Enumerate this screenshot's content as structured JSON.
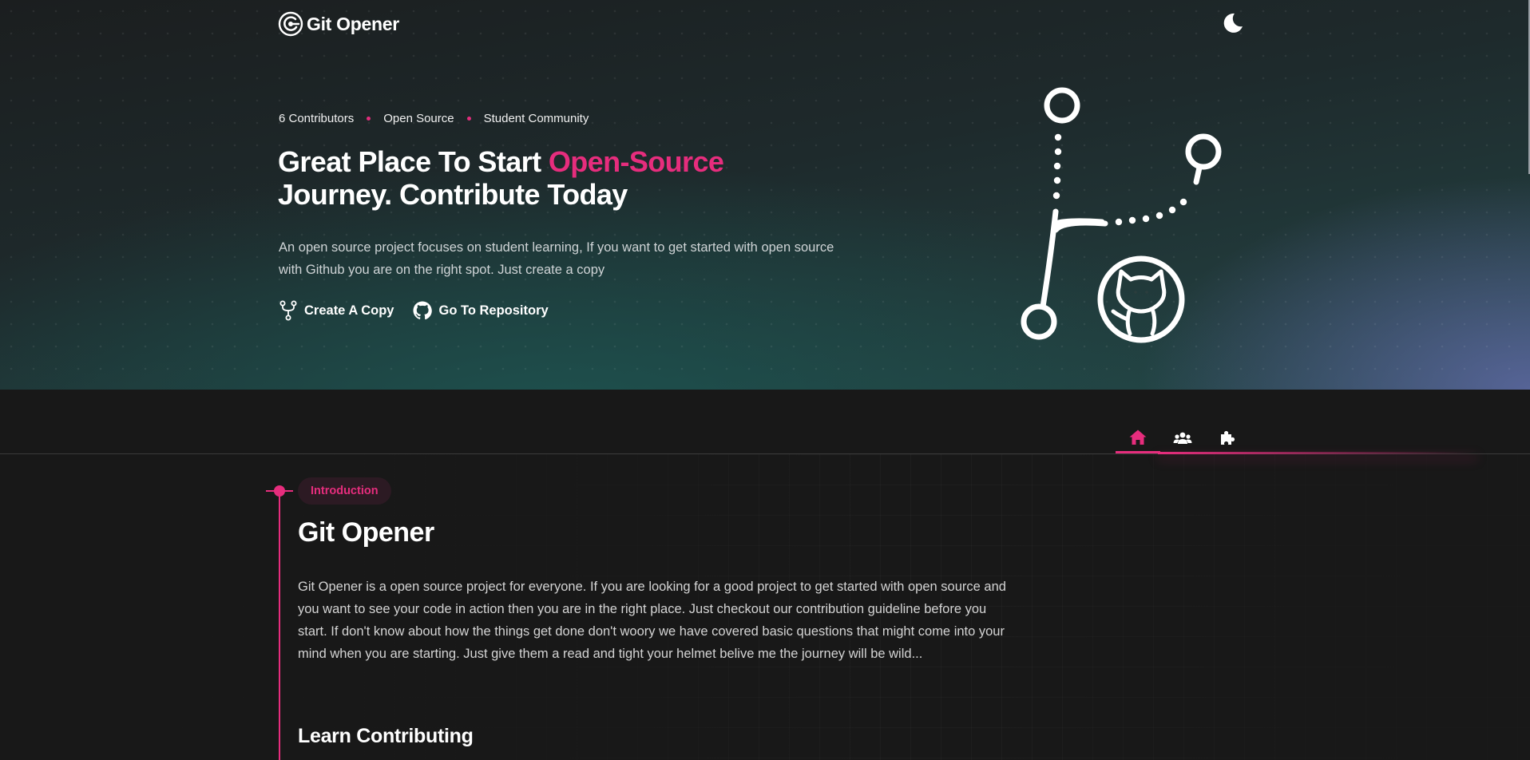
{
  "header": {
    "logo_text": "Git Opener",
    "theme_toggle_icon": "moon-icon"
  },
  "hero": {
    "meta": [
      "6 Contributors",
      "Open Source",
      "Student Community"
    ],
    "headline_part1": "Great Place To Start ",
    "headline_accent": "Open-Source",
    "headline_part2": "Journey. Contribute Today",
    "description": "An open source project focuses on student learning, If you want to get started with open source with Github you are on the right spot. Just create a copy",
    "actions": [
      {
        "label": "Create A Copy",
        "icon": "fork-icon"
      },
      {
        "label": "Go To Repository",
        "icon": "github-icon"
      }
    ],
    "illustration": "git-branch-octocat-illustration"
  },
  "nav": {
    "icons": [
      {
        "name": "home-icon",
        "active": true
      },
      {
        "name": "community-icon",
        "active": false
      },
      {
        "name": "puzzle-icon",
        "active": false
      }
    ]
  },
  "main": {
    "badge": "Introduction",
    "title": "Git Opener",
    "paragraph": "Git Opener is a open source project for everyone. If you are looking for a good project to get started with open source and you want to see your code in action then you are in the right place. Just checkout our contribution guideline before you start. If don't know about how the things get done don't woory we have covered basic questions that might come into your mind when you are starting. Just give them a read and tight your helmet belive me the journey will be wild...",
    "subtitle": "Learn Contributing"
  },
  "colors": {
    "accent": "#e62d7d",
    "background": "#181818"
  }
}
